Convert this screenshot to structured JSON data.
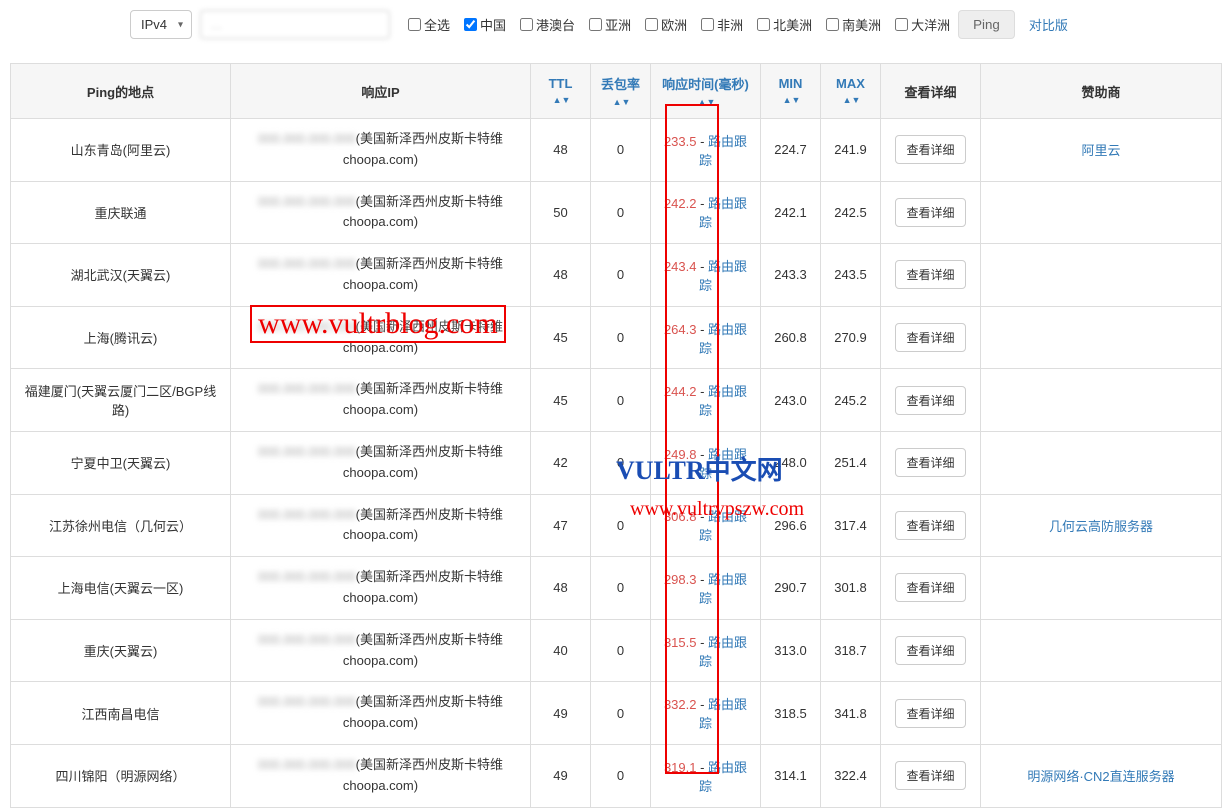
{
  "toolbar": {
    "protocol": "IPv4",
    "ip_input": "...",
    "checkboxes": {
      "all": "全选",
      "china": "中国",
      "hmt": "港澳台",
      "asia": "亚洲",
      "europe": "欧洲",
      "africa": "非洲",
      "namerica": "北美洲",
      "samerica": "南美洲",
      "oceania": "大洋洲"
    },
    "ping_btn": "Ping",
    "compare": "对比版"
  },
  "headers": {
    "location": "Ping的地点",
    "resp_ip": "响应IP",
    "ttl": "TTL",
    "loss": "丢包率",
    "resp_time": "响应时间(毫秒)",
    "min": "MIN",
    "max": "MAX",
    "detail": "查看详细",
    "sponsor": "赞助商"
  },
  "labels": {
    "route_trace": "路由跟踪",
    "detail_btn": "查看详细",
    "ip_suffix": "(美国新泽西州皮斯卡特维choopa.com)"
  },
  "rows": [
    {
      "location": "山东青岛(阿里云)",
      "ttl": "48",
      "loss": "0",
      "resp": "233.5",
      "min": "224.7",
      "max": "241.9",
      "sponsor": "阿里云"
    },
    {
      "location": "重庆联通",
      "ttl": "50",
      "loss": "0",
      "resp": "242.2",
      "min": "242.1",
      "max": "242.5",
      "sponsor": ""
    },
    {
      "location": "湖北武汉(天翼云)",
      "ttl": "48",
      "loss": "0",
      "resp": "243.4",
      "min": "243.3",
      "max": "243.5",
      "sponsor": ""
    },
    {
      "location": "上海(腾讯云)",
      "ttl": "45",
      "loss": "0",
      "resp": "264.3",
      "min": "260.8",
      "max": "270.9",
      "sponsor": ""
    },
    {
      "location": "福建厦门(天翼云厦门二区/BGP线路)",
      "ttl": "45",
      "loss": "0",
      "resp": "244.2",
      "min": "243.0",
      "max": "245.2",
      "sponsor": ""
    },
    {
      "location": "宁夏中卫(天翼云)",
      "ttl": "42",
      "loss": "0",
      "resp": "249.8",
      "min": "248.0",
      "max": "251.4",
      "sponsor": ""
    },
    {
      "location": "江苏徐州电信（几何云）",
      "ttl": "47",
      "loss": "0",
      "resp": "306.8",
      "min": "296.6",
      "max": "317.4",
      "sponsor": "几何云高防服务器"
    },
    {
      "location": "上海电信(天翼云一区)",
      "ttl": "48",
      "loss": "0",
      "resp": "298.3",
      "min": "290.7",
      "max": "301.8",
      "sponsor": ""
    },
    {
      "location": "重庆(天翼云)",
      "ttl": "40",
      "loss": "0",
      "resp": "315.5",
      "min": "313.0",
      "max": "318.7",
      "sponsor": ""
    },
    {
      "location": "江西南昌电信",
      "ttl": "49",
      "loss": "0",
      "resp": "332.2",
      "min": "318.5",
      "max": "341.8",
      "sponsor": ""
    },
    {
      "location": "四川锦阳（明源网络）",
      "ttl": "49",
      "loss": "0",
      "resp": "319.1",
      "min": "314.1",
      "max": "322.4",
      "sponsor": "明源网络·CN2直连服务器"
    }
  ],
  "watermarks": {
    "w1": "www.vultrblog.com",
    "w2a": "VULTR",
    "w2b": "中文网",
    "w3": "www.vultrvpszw.com"
  }
}
